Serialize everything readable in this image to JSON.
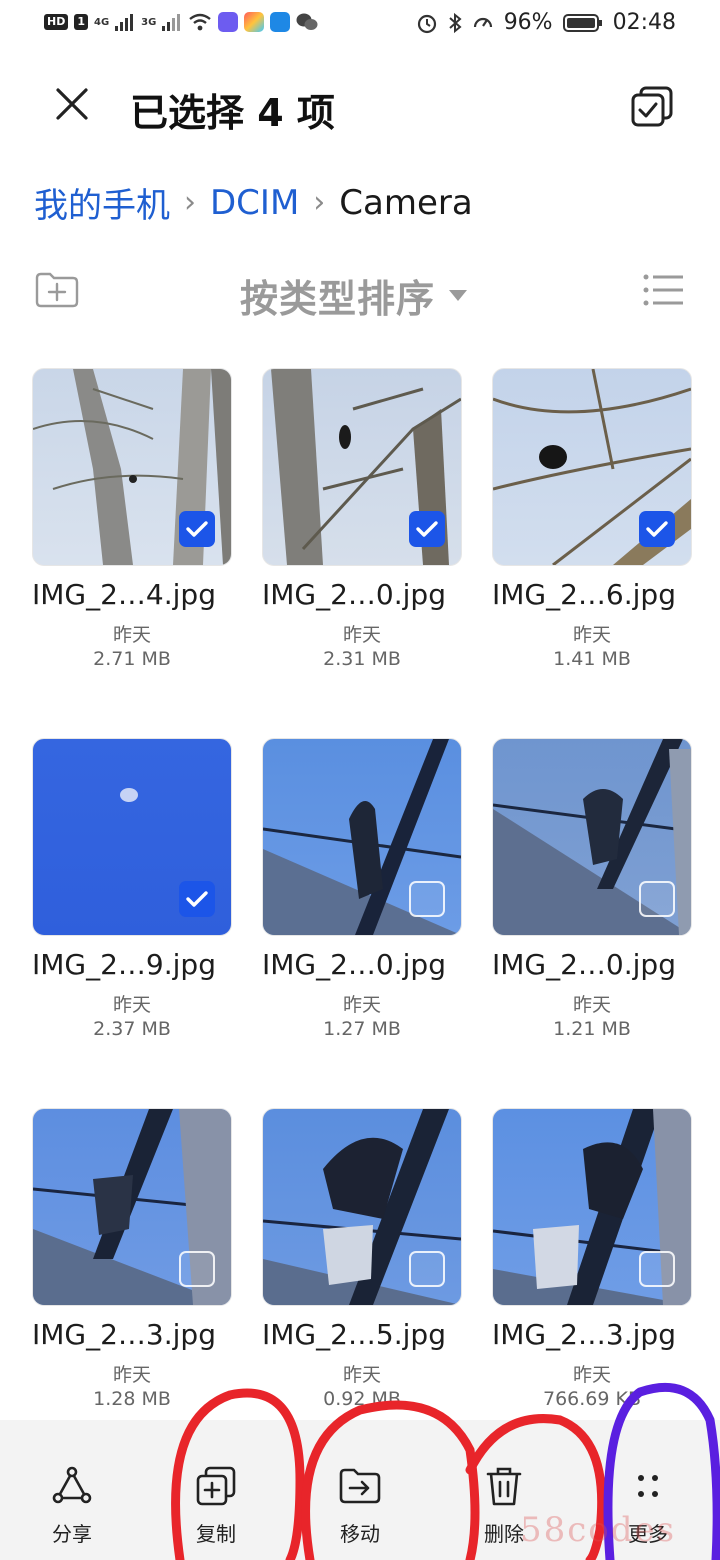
{
  "status_bar": {
    "left_chip": "HD",
    "sim": "1",
    "net1": "4G",
    "net2": "3G",
    "battery": "96%",
    "time": "02:48"
  },
  "header": {
    "title": "已选择 4 项"
  },
  "breadcrumb": {
    "items": [
      "我的手机",
      "DCIM",
      "Camera"
    ]
  },
  "toolbar": {
    "sort_label": "按类型排序"
  },
  "files": [
    {
      "name": "IMG_2…4.jpg",
      "date": "昨天",
      "size": "2.71 MB",
      "selected": true
    },
    {
      "name": "IMG_2…0.jpg",
      "date": "昨天",
      "size": "2.31 MB",
      "selected": true
    },
    {
      "name": "IMG_2…6.jpg",
      "date": "昨天",
      "size": "1.41 MB",
      "selected": true
    },
    {
      "name": "IMG_2…9.jpg",
      "date": "昨天",
      "size": "2.37 MB",
      "selected": true
    },
    {
      "name": "IMG_2…0.jpg",
      "date": "昨天",
      "size": "1.27 MB",
      "selected": false
    },
    {
      "name": "IMG_2…0.jpg",
      "date": "昨天",
      "size": "1.21 MB",
      "selected": false
    },
    {
      "name": "IMG_2…3.jpg",
      "date": "昨天",
      "size": "1.28 MB",
      "selected": false
    },
    {
      "name": "IMG_2…5.jpg",
      "date": "昨天",
      "size": "0.92 MB",
      "selected": false
    },
    {
      "name": "IMG_2…3.jpg",
      "date": "昨天",
      "size": "766.69 KB",
      "selected": false
    }
  ],
  "actions": {
    "share": "分享",
    "copy": "复制",
    "move": "移动",
    "delete": "删除",
    "more": "更多"
  },
  "watermark": "58codes",
  "colors": {
    "accent": "#1c55e8",
    "link": "#1f5fd1",
    "annotation_red": "#e8252a",
    "annotation_purple": "#5a1fe0"
  }
}
